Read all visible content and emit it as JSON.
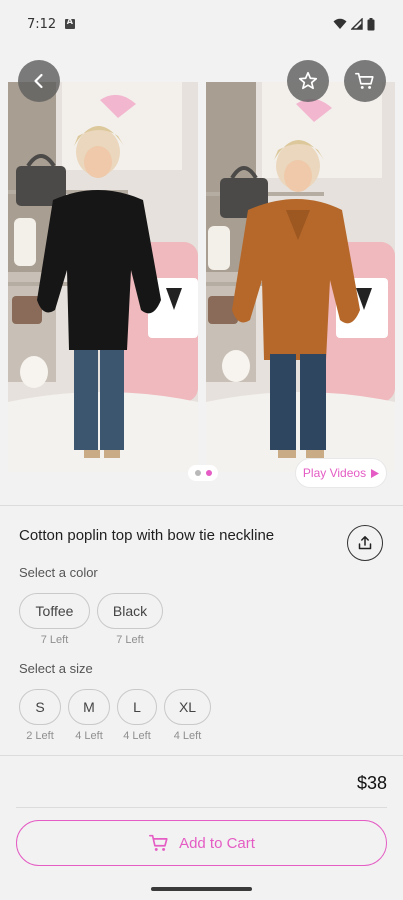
{
  "status_bar": {
    "time": "7:12"
  },
  "gallery": {
    "play_videos_label": "Play Videos",
    "page_count": 2,
    "active_page": 2
  },
  "product": {
    "title": "Cotton poplin top with bow tie neckline",
    "price": "$38"
  },
  "color_selector": {
    "label": "Select a color",
    "options": [
      {
        "name": "Toffee",
        "stock": "7 Left"
      },
      {
        "name": "Black",
        "stock": "7 Left"
      }
    ]
  },
  "size_selector": {
    "label": "Select a size",
    "options": [
      {
        "name": "S",
        "stock": "2 Left"
      },
      {
        "name": "M",
        "stock": "4 Left"
      },
      {
        "name": "L",
        "stock": "4 Left"
      },
      {
        "name": "XL",
        "stock": "4 Left"
      }
    ]
  },
  "actions": {
    "add_to_cart_label": "Add to Cart"
  },
  "colors": {
    "accent": "#e45cc4",
    "background": "#f2f2f2"
  }
}
